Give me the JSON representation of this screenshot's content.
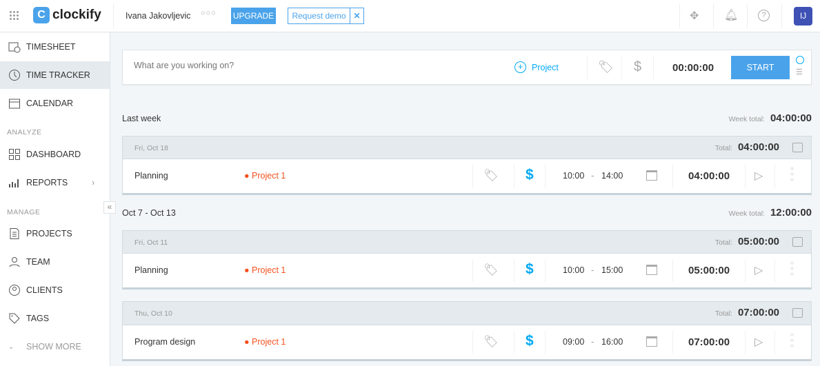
{
  "topbar": {
    "brand": "clockify",
    "user": "Ivana Jakovljevic",
    "upgrade": "UPGRADE",
    "request_demo": "Request demo",
    "avatar": "IJ"
  },
  "sidebar": {
    "items": [
      {
        "label": "TIMESHEET",
        "icon": "timesheet-icon"
      },
      {
        "label": "TIME TRACKER",
        "icon": "clock-icon",
        "active": true
      },
      {
        "label": "CALENDAR",
        "icon": "calendar-icon"
      },
      {
        "label": "DASHBOARD",
        "icon": "dashboard-icon"
      },
      {
        "label": "REPORTS",
        "icon": "reports-icon"
      },
      {
        "label": "PROJECTS",
        "icon": "projects-icon"
      },
      {
        "label": "TEAM",
        "icon": "team-icon"
      },
      {
        "label": "CLIENTS",
        "icon": "clients-icon"
      },
      {
        "label": "TAGS",
        "icon": "tag-icon"
      }
    ],
    "analyze": "ANALYZE",
    "manage": "MANAGE",
    "show_more": "SHOW MORE"
  },
  "timer": {
    "placeholder": "What are you working on?",
    "project": "Project",
    "time": "00:00:00",
    "start": "START"
  },
  "labels": {
    "week_total": "Week total:",
    "total": "Total:"
  },
  "weeks": [
    {
      "title": "Last week",
      "total": "04:00:00",
      "days": [
        {
          "date": "Fri, Oct 18",
          "total": "04:00:00",
          "entries": [
            {
              "description": "Planning",
              "project": "Project 1",
              "start": "10:00",
              "end": "14:00",
              "duration": "04:00:00"
            }
          ]
        }
      ]
    },
    {
      "title": "Oct 7 - Oct 13",
      "total": "12:00:00",
      "days": [
        {
          "date": "Fri, Oct 11",
          "total": "05:00:00",
          "entries": [
            {
              "description": "Planning",
              "project": "Project 1",
              "start": "10:00",
              "end": "15:00",
              "duration": "05:00:00"
            }
          ]
        },
        {
          "date": "Thu, Oct 10",
          "total": "07:00:00",
          "entries": [
            {
              "description": "Program design",
              "project": "Project 1",
              "start": "09:00",
              "end": "16:00",
              "duration": "07:00:00"
            }
          ]
        }
      ]
    }
  ],
  "colors": {
    "accent": "#03a9f4",
    "button": "#4aa3ea",
    "project": "#f4511e",
    "active_bg": "#e4eaee"
  }
}
